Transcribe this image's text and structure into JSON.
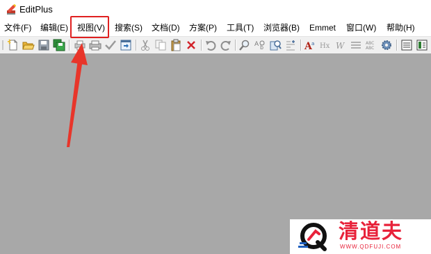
{
  "window": {
    "title": "EditPlus"
  },
  "menubar": {
    "items": [
      {
        "label": "文件(F)"
      },
      {
        "label": "编辑(E)"
      },
      {
        "label": "视图(V)"
      },
      {
        "label": "搜索(S)"
      },
      {
        "label": "文档(D)"
      },
      {
        "label": "方案(P)"
      },
      {
        "label": "工具(T)"
      },
      {
        "label": "浏览器(B)"
      },
      {
        "label": "Emmet"
      },
      {
        "label": "窗口(W)"
      },
      {
        "label": "帮助(H)"
      }
    ]
  },
  "toolbar": {
    "buttons": [
      "new-file-icon",
      "open-folder-icon",
      "save-icon",
      "save-all-icon",
      "print-preview-icon",
      "print-icon",
      "spell-check-icon",
      "browser-view-icon",
      "cut-icon",
      "copy-icon",
      "paste-icon",
      "delete-icon",
      "undo-icon",
      "redo-icon",
      "find-icon",
      "replace-icon",
      "find-in-files-icon",
      "goto-line-icon",
      "font-icon",
      "hex-icon",
      "word-wrap-icon",
      "ruler-icon",
      "column-icon",
      "settings-icon",
      "window-list-icon",
      "panel-icon"
    ]
  },
  "annotation": {
    "highlight_color": "#e02020",
    "target": "视图(V)"
  },
  "watermark": {
    "name": "清道夫",
    "url": "WWW.QDFUJI.COM",
    "color": "#e8223a"
  },
  "colors": {
    "workspace": "#a8a8a8",
    "toolbar": "#f0f0f0"
  }
}
